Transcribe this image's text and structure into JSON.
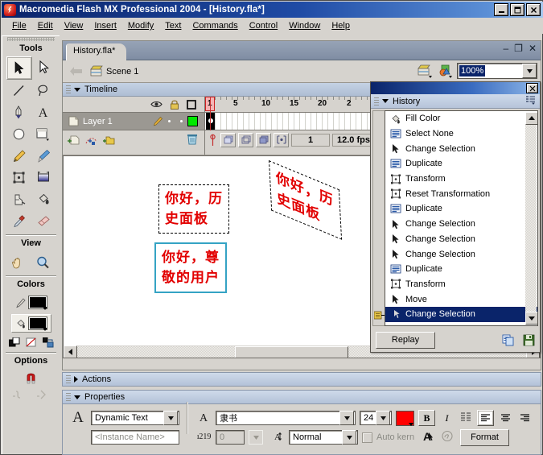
{
  "window": {
    "title": "Macromedia Flash MX Professional 2004 - [History.fla*]",
    "icon": "flash-logo-icon",
    "minimize": "minimize-icon",
    "maximize": "maximize-icon",
    "close": "close-icon"
  },
  "menubar": {
    "items": [
      {
        "label": "File"
      },
      {
        "label": "Edit"
      },
      {
        "label": "View"
      },
      {
        "label": "Insert"
      },
      {
        "label": "Modify"
      },
      {
        "label": "Text"
      },
      {
        "label": "Commands"
      },
      {
        "label": "Control"
      },
      {
        "label": "Window"
      },
      {
        "label": "Help"
      }
    ]
  },
  "tools": {
    "heading": "Tools",
    "items": [
      {
        "name": "selection-tool",
        "selected": true
      },
      {
        "name": "subselection-tool",
        "selected": false
      },
      {
        "name": "line-tool",
        "selected": false
      },
      {
        "name": "lasso-tool",
        "selected": false
      },
      {
        "name": "pen-tool",
        "selected": false
      },
      {
        "name": "text-tool",
        "selected": false
      },
      {
        "name": "oval-tool",
        "selected": false
      },
      {
        "name": "rectangle-tool",
        "selected": false
      },
      {
        "name": "pencil-tool",
        "selected": false
      },
      {
        "name": "brush-tool",
        "selected": false
      },
      {
        "name": "free-transform-tool",
        "selected": false
      },
      {
        "name": "fill-transform-tool",
        "selected": false
      },
      {
        "name": "ink-bottle-tool",
        "selected": false
      },
      {
        "name": "paint-bucket-tool",
        "selected": false
      },
      {
        "name": "eyedropper-tool",
        "selected": false
      },
      {
        "name": "eraser-tool",
        "selected": false
      }
    ],
    "view_heading": "View",
    "view_items": [
      {
        "name": "hand-tool"
      },
      {
        "name": "zoom-tool"
      }
    ],
    "colors_heading": "Colors",
    "stroke_color": "#000000",
    "fill_color": "#000000",
    "options_heading": "Options",
    "option_items": [
      {
        "name": "snap-to-objects-magnet-icon"
      },
      {
        "name": "smooth-icon"
      },
      {
        "name": "straighten-icon"
      }
    ]
  },
  "document": {
    "tab_label": "History.fla*",
    "minimize": "minimize-icon",
    "restore": "restore-icon",
    "close": "close-icon",
    "scene_label": "Scene 1",
    "back_arrow": "back-arrow-icon",
    "edit_scene_icon": "edit-scene-icon",
    "edit_symbols_icon": "edit-symbols-icon",
    "zoom_value": "100%"
  },
  "timeline": {
    "title": "Timeline",
    "expanded": true,
    "columns": {
      "eye": "eye-icon",
      "lock": "lock-icon",
      "outline": "outline-icon"
    },
    "layers": [
      {
        "name": "Layer 1",
        "pencil": "pencil-icon",
        "color": "#00e800"
      }
    ],
    "layer_buttons": [
      {
        "name": "insert-layer-button"
      },
      {
        "name": "add-motion-guide-button"
      },
      {
        "name": "insert-layer-folder-button"
      },
      {
        "name": "delete-layer-button"
      }
    ],
    "ruler_labels": [
      "1",
      "5",
      "10",
      "15",
      "20",
      "2"
    ],
    "controls": [
      {
        "name": "center-frame-button"
      },
      {
        "name": "onion-skin-button"
      },
      {
        "name": "onion-skin-outlines-button"
      },
      {
        "name": "edit-multiple-frames-button"
      },
      {
        "name": "modify-onion-markers-button"
      }
    ],
    "current_frame": "1",
    "frame_rate": "12.0 fps",
    "elapsed_time": ""
  },
  "stage": {
    "text_blocks": [
      {
        "id": "text-block-history-panel",
        "lines": "你好，历\n史面板",
        "border": "dotted",
        "color": "#e20000"
      },
      {
        "id": "text-block-dear-user",
        "lines": "你好，尊\n敬的用户",
        "border": "solid",
        "color": "#e20000"
      },
      {
        "id": "text-block-transformed",
        "lines": "你好，历\n史面板",
        "border": "dotted",
        "color": "#e20000"
      }
    ]
  },
  "history": {
    "close": "close-icon",
    "title": "History",
    "options_menu": "panel-options-icon",
    "items": [
      {
        "label": "Fill Color",
        "icon": "paint-bucket-icon",
        "selected": false
      },
      {
        "label": "Select None",
        "icon": "select-icon",
        "selected": false
      },
      {
        "label": "Change Selection",
        "icon": "arrow-icon",
        "selected": false
      },
      {
        "label": "Duplicate",
        "icon": "select-icon",
        "selected": false
      },
      {
        "label": "Transform",
        "icon": "transform-icon",
        "selected": false
      },
      {
        "label": "Reset Transformation",
        "icon": "transform-icon",
        "selected": false
      },
      {
        "label": "Duplicate",
        "icon": "select-icon",
        "selected": false
      },
      {
        "label": "Change Selection",
        "icon": "arrow-icon",
        "selected": false
      },
      {
        "label": "Change Selection",
        "icon": "arrow-icon",
        "selected": false
      },
      {
        "label": "Change Selection",
        "icon": "arrow-icon",
        "selected": false
      },
      {
        "label": "Duplicate",
        "icon": "select-icon",
        "selected": false
      },
      {
        "label": "Transform",
        "icon": "transform-icon",
        "selected": false
      },
      {
        "label": "Move",
        "icon": "arrow-icon",
        "selected": false
      },
      {
        "label": "Change Selection",
        "icon": "arrow-icon",
        "selected": true
      }
    ],
    "replay_label": "Replay",
    "copy_steps_icon": "copy-steps-icon",
    "save_as_command_icon": "save-as-command-icon",
    "scroll_up": "scroll-up-icon",
    "scroll_down": "scroll-down-icon"
  },
  "panels": {
    "actions_title": "Actions",
    "actions_expanded": false,
    "properties_title": "Properties",
    "properties_expanded": true
  },
  "properties": {
    "type_icon": "text-tool-icon",
    "text_type": "Dynamic Text",
    "instance_name_placeholder": "<Instance Name>",
    "font_icon": "font-icon",
    "font_family": "隶书",
    "letter_spacing_icon": "letter-spacing-icon",
    "letter_spacing": "0",
    "baseline_icon": "character-position-icon",
    "character_position": "Normal",
    "font_size": "24",
    "text_color": "#ff0000",
    "bold_label": "B",
    "italic_label": "I",
    "direction_icon": "text-direction-icon",
    "align_left_icon": "align-left-icon",
    "align_center_icon": "align-center-icon",
    "align_right_icon": "align-right-icon",
    "auto_kern_label": "Auto kern",
    "auto_kern_checked": false,
    "selectable_icon": "selectable-icon",
    "render_icon": "render-text-as-html-icon",
    "format_label": "Format"
  }
}
